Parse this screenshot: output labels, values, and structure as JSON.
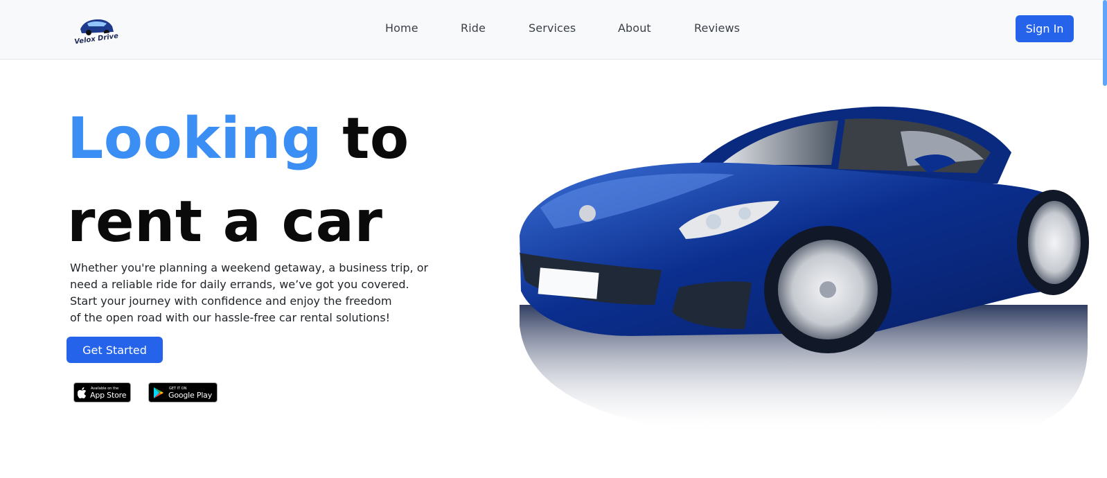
{
  "brand": {
    "logo_text": "Velox Drive"
  },
  "nav": {
    "items": [
      {
        "label": "Home"
      },
      {
        "label": "Ride"
      },
      {
        "label": "Services"
      },
      {
        "label": "About"
      },
      {
        "label": "Reviews"
      }
    ],
    "signin_label": "Sign In"
  },
  "hero": {
    "title_accent": "Looking",
    "title_rest": "to",
    "title_line2": "rent a car",
    "description_lines": [
      "Whether you're planning a weekend getaway, a business trip, or",
      "need a reliable ride for daily errands, we’ve got you covered.",
      "Start your journey with confidence and enjoy the freedom",
      "of the open road with our hassle-free car rental solutions!"
    ],
    "cta_label": "Get Started"
  },
  "badges": {
    "app_store": {
      "small": "Available on the",
      "big": "App Store"
    },
    "google_play": {
      "small": "GET IT ON",
      "big": "Google Play"
    }
  },
  "colors": {
    "accent": "#3b8ef3",
    "primary_button": "#2563eb",
    "navbar_bg": "#f8f9fb",
    "car_body": "#0b2f8f"
  }
}
